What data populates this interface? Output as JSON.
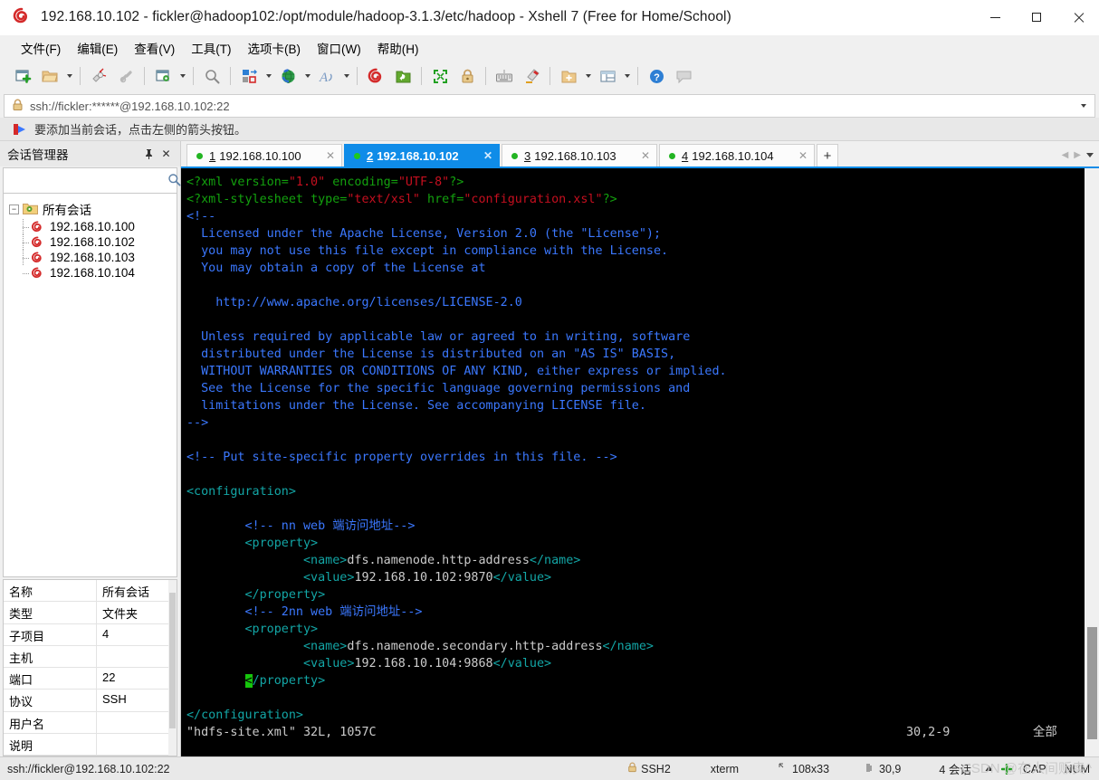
{
  "window": {
    "title": "192.168.10.102 - fickler@hadoop102:/opt/module/hadoop-3.1.3/etc/hadoop - Xshell 7 (Free for Home/School)",
    "minimize_label": "—",
    "maximize_label": "□",
    "close_label": "✕"
  },
  "menu": [
    {
      "text": "文件(F)",
      "key": "F"
    },
    {
      "text": "编辑(E)",
      "key": "E"
    },
    {
      "text": "查看(V)",
      "key": "V"
    },
    {
      "text": "工具(T)",
      "key": "T"
    },
    {
      "text": "选项卡(B)",
      "key": "B"
    },
    {
      "text": "窗口(W)",
      "key": "W"
    },
    {
      "text": "帮助(H)",
      "key": "H"
    }
  ],
  "toolbar": {
    "icons": [
      "new-session-icon",
      "open-folder-icon",
      "disconnect-icon",
      "reconnect-icon",
      "session-properties-icon",
      "find-icon",
      "transfer-file-icon",
      "web-icon",
      "font-icon",
      "xshell-icon",
      "xftp-icon",
      "fullscreen-icon",
      "lock-icon",
      "keyboard-icon",
      "highlight-icon",
      "add-folder-icon",
      "layout-icon",
      "help-icon",
      "comment-icon"
    ]
  },
  "address": {
    "value": "ssh://fickler:******@192.168.10.102:22",
    "lock_icon": "lock-icon",
    "caret_icon": "chevron-down-icon"
  },
  "notice": {
    "icon": "red-arrow-icon",
    "text": "要添加当前会话，点击左侧的箭头按钮。"
  },
  "sidebar": {
    "title": "会话管理器",
    "pin_label": "⚐",
    "close_label": "✕",
    "search_placeholder": "",
    "search_value": "",
    "search_icon": "search-icon",
    "tree": {
      "root_label": "所有会话",
      "expander": "−",
      "children": [
        {
          "label": "192.168.10.100"
        },
        {
          "label": "192.168.10.102"
        },
        {
          "label": "192.168.10.103"
        },
        {
          "label": "192.168.10.104"
        }
      ]
    },
    "properties": [
      {
        "key": "名称",
        "value": "所有会话"
      },
      {
        "key": "类型",
        "value": "文件夹"
      },
      {
        "key": "子项目",
        "value": "4"
      },
      {
        "key": "主机",
        "value": ""
      },
      {
        "key": "端口",
        "value": "22"
      },
      {
        "key": "协议",
        "value": "SSH"
      },
      {
        "key": "用户名",
        "value": ""
      },
      {
        "key": "说明",
        "value": ""
      }
    ]
  },
  "tabs": {
    "items": [
      {
        "num": "1",
        "label": "192.168.10.100",
        "active": false,
        "status": "connected"
      },
      {
        "num": "2",
        "label": "192.168.10.102",
        "active": true,
        "status": "connected"
      },
      {
        "num": "3",
        "label": "192.168.10.103",
        "active": false,
        "status": "connected"
      },
      {
        "num": "4",
        "label": "192.168.10.104",
        "active": false,
        "status": "connected"
      }
    ],
    "add_label": "+",
    "close_label": "✕",
    "nav_prev": "◀",
    "nav_next": "▶"
  },
  "terminal": {
    "lines": [
      [
        {
          "t": "<?xml ",
          "c": "g"
        },
        {
          "t": "version=",
          "c": "g"
        },
        {
          "t": "\"1.0\"",
          "c": "r"
        },
        {
          "t": " encoding=",
          "c": "g"
        },
        {
          "t": "\"UTF-8\"",
          "c": "r"
        },
        {
          "t": "?>",
          "c": "g"
        }
      ],
      [
        {
          "t": "<?xml-stylesheet ",
          "c": "g"
        },
        {
          "t": "type=",
          "c": "g"
        },
        {
          "t": "\"text/xsl\"",
          "c": "r"
        },
        {
          "t": " href=",
          "c": "g"
        },
        {
          "t": "\"configuration.xsl\"",
          "c": "r"
        },
        {
          "t": "?>",
          "c": "g"
        }
      ],
      [
        {
          "t": "<!--",
          "c": "b"
        }
      ],
      [
        {
          "t": "  Licensed under the Apache License, Version 2.0 (the \"License\");",
          "c": "b"
        }
      ],
      [
        {
          "t": "  you may not use this file except in compliance with the License.",
          "c": "b"
        }
      ],
      [
        {
          "t": "  You may obtain a copy of the License at",
          "c": "b"
        }
      ],
      [
        {
          "t": "",
          "c": "b"
        }
      ],
      [
        {
          "t": "    http://www.apache.org/licenses/LICENSE-2.0",
          "c": "b"
        }
      ],
      [
        {
          "t": "",
          "c": "b"
        }
      ],
      [
        {
          "t": "  Unless required by applicable law or agreed to in writing, software",
          "c": "b"
        }
      ],
      [
        {
          "t": "  distributed under the License is distributed on an \"AS IS\" BASIS,",
          "c": "b"
        }
      ],
      [
        {
          "t": "  WITHOUT WARRANTIES OR CONDITIONS OF ANY KIND, either express or implied.",
          "c": "b"
        }
      ],
      [
        {
          "t": "  See the License for the specific language governing permissions and",
          "c": "b"
        }
      ],
      [
        {
          "t": "  limitations under the License. See accompanying LICENSE file.",
          "c": "b"
        }
      ],
      [
        {
          "t": "-->",
          "c": "b"
        }
      ],
      [
        {
          "t": "",
          "c": "b"
        }
      ],
      [
        {
          "t": "<!-- Put site-specific property overrides in this file. -->",
          "c": "b"
        }
      ],
      [
        {
          "t": "",
          "c": "b"
        }
      ],
      [
        {
          "t": "<configuration>",
          "c": "c"
        }
      ],
      [
        {
          "t": "",
          "c": "c"
        }
      ],
      [
        {
          "t": "        ",
          "c": "w"
        },
        {
          "t": "<!-- nn web 端访问地址-->",
          "c": "b"
        }
      ],
      [
        {
          "t": "        ",
          "c": "w"
        },
        {
          "t": "<property>",
          "c": "c"
        }
      ],
      [
        {
          "t": "                ",
          "c": "w"
        },
        {
          "t": "<name>",
          "c": "c"
        },
        {
          "t": "dfs.namenode.http-address",
          "c": "w"
        },
        {
          "t": "</name>",
          "c": "c"
        }
      ],
      [
        {
          "t": "                ",
          "c": "w"
        },
        {
          "t": "<value>",
          "c": "c"
        },
        {
          "t": "192.168.10.102:9870",
          "c": "w"
        },
        {
          "t": "</value>",
          "c": "c"
        }
      ],
      [
        {
          "t": "        ",
          "c": "w"
        },
        {
          "t": "</property>",
          "c": "c"
        }
      ],
      [
        {
          "t": "        ",
          "c": "w"
        },
        {
          "t": "<!-- 2nn web 端访问地址-->",
          "c": "b"
        }
      ],
      [
        {
          "t": "        ",
          "c": "w"
        },
        {
          "t": "<property>",
          "c": "c"
        }
      ],
      [
        {
          "t": "                ",
          "c": "w"
        },
        {
          "t": "<name>",
          "c": "c"
        },
        {
          "t": "dfs.namenode.secondary.http-address",
          "c": "w"
        },
        {
          "t": "</name>",
          "c": "c"
        }
      ],
      [
        {
          "t": "                ",
          "c": "w"
        },
        {
          "t": "<value>",
          "c": "c"
        },
        {
          "t": "192.168.10.104:9868",
          "c": "w"
        },
        {
          "t": "</value>",
          "c": "c"
        }
      ],
      [
        {
          "t": "        ",
          "c": "w"
        },
        {
          "t": "<",
          "c": "cursor"
        },
        {
          "t": "/property>",
          "c": "c"
        }
      ],
      [
        {
          "t": "",
          "c": "c"
        }
      ],
      [
        {
          "t": "</configuration>",
          "c": "c"
        }
      ]
    ],
    "vim_status": {
      "file": "\"hdfs-site.xml\" 32L, 1057C",
      "position": "30,2-9",
      "scroll": "全部"
    }
  },
  "statusbar": {
    "connection": "ssh://fickler@192.168.10.102:22",
    "security": "SSH2",
    "security_icon": "lock-icon",
    "terminal_type": "xterm",
    "size_icon": "resize-icon",
    "size": "108x33",
    "cursor_icon": "cursor-icon",
    "cursor": "30,9",
    "sessions": "4 会话",
    "caps": "CAP",
    "num": "NUM",
    "watermark": "CSDN @在人间贩卖^"
  },
  "colors": {
    "accent": "#0f8ce8",
    "terminal_bg": "#000000",
    "xml_tag_green": "#13a10e",
    "xml_attr_red": "#c50f1f",
    "comment_blue": "#3b78ff",
    "tag_teal": "#13a6a6",
    "text_white": "#cccccc",
    "cursor_green": "#16c60c",
    "status_dot_green": "#22b422"
  }
}
